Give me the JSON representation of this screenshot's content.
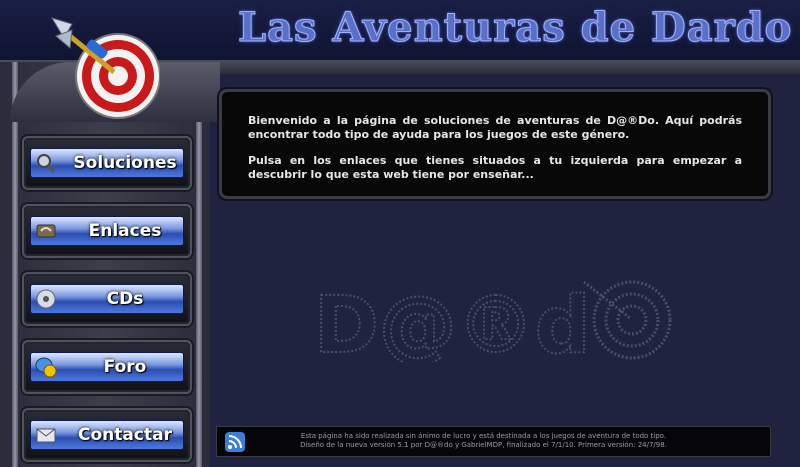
{
  "header": {
    "title": "Las Aventuras de Dardo"
  },
  "nav": {
    "items": [
      {
        "label": "Soluciones",
        "icon": "search-icon"
      },
      {
        "label": "Enlaces",
        "icon": "link-icon"
      },
      {
        "label": "CDs",
        "icon": "cd-icon"
      },
      {
        "label": "Foro",
        "icon": "forum-icon"
      },
      {
        "label": "Contactar",
        "icon": "mail-icon"
      }
    ]
  },
  "main": {
    "welcome_p1": "Bienvenido a la página de soluciones de aventuras de D@®Do. Aquí podrás encontrar todo tipo de ayuda para los juegos de este género.",
    "welcome_p2": "Pulsa en los enlaces que tienes situados a tu izquierda para empezar a descubrir lo que esta web tiene por enseñar...",
    "watermark": "D@®d"
  },
  "footer": {
    "line1": "Esta página ha sido realizada sin ánimo de lucro y está destinada a los juegos de aventura de todo tipo.",
    "line2": "Diseño de la nueva versión 5.1 por D@®do y GabrielMDP, finalizado el 7/1/10. Primera versión: 24/7/98."
  },
  "colors": {
    "background": "#1f2340",
    "title": "#5a6fc8",
    "button_blue": "#2c4fb0",
    "target_red": "#c81a1a"
  }
}
